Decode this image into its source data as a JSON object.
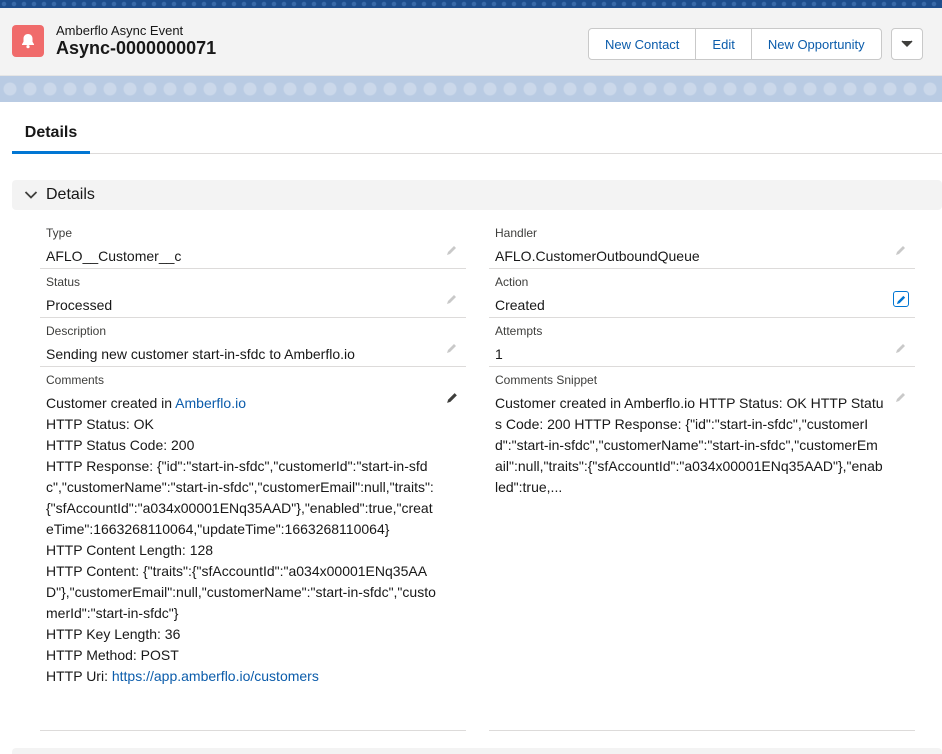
{
  "header": {
    "object_type": "Amberflo Async Event",
    "record_name": "Async-0000000071",
    "icon": "bell-icon",
    "icon_color": "#f06b6b",
    "buttons": [
      "New Contact",
      "Edit",
      "New Opportunity"
    ],
    "menu_icon": "chevron-down-icon"
  },
  "tabs": [
    "Details"
  ],
  "section": {
    "title": "Details",
    "icon": "chevron-down-icon"
  },
  "fields": {
    "type": {
      "label": "Type",
      "value": "AFLO__Customer__c"
    },
    "handler": {
      "label": "Handler",
      "value": "AFLO.CustomerOutboundQueue"
    },
    "status": {
      "label": "Status",
      "value": "Processed"
    },
    "action": {
      "label": "Action",
      "value": "Created"
    },
    "description": {
      "label": "Description",
      "value": "Sending new customer start-in-sfdc to Amberflo.io"
    },
    "attempts": {
      "label": "Attempts",
      "value": "1"
    },
    "comments": {
      "label": "Comments",
      "line1_prefix": "Customer created in ",
      "line1_link": "Amberflo.io",
      "line2": "HTTP Status: OK",
      "line3": "HTTP Status Code: 200",
      "line4": "HTTP Response: {\"id\":\"start-in-sfdc\",\"customerId\":\"start-in-sfdc\",\"customerName\":\"start-in-sfdc\",\"customerEmail\":null,\"traits\":{\"sfAccountId\":\"a034x00001ENq35AAD\"},\"enabled\":true,\"createTime\":1663268110064,\"updateTime\":1663268110064}",
      "line5": "HTTP Content Length: 128",
      "line6": "HTTP Content: {\"traits\":{\"sfAccountId\":\"a034x00001ENq35AAD\"},\"customerEmail\":null,\"customerName\":\"start-in-sfdc\",\"customerId\":\"start-in-sfdc\"}",
      "line7": "HTTP Key Length: 36",
      "line8": "HTTP Method: POST",
      "line9_prefix": "HTTP Uri: ",
      "line9_link": "https://app.amberflo.io/customers"
    },
    "comments_snippet": {
      "label": "Comments Snippet",
      "value": "Customer created in Amberflo.io HTTP Status: OK HTTP Status Code: 200 HTTP Response: {\"id\":\"start-in-sfdc\",\"customerId\":\"start-in-sfdc\",\"customerName\":\"start-in-sfdc\",\"customerEmail\":null,\"traits\":{\"sfAccountId\":\"a034x00001ENq35AAD\"},\"enabled\":true,..."
    }
  },
  "colors": {
    "accent": "#0176d3",
    "link": "#0b5cab",
    "record_icon": "#f06b6b"
  }
}
